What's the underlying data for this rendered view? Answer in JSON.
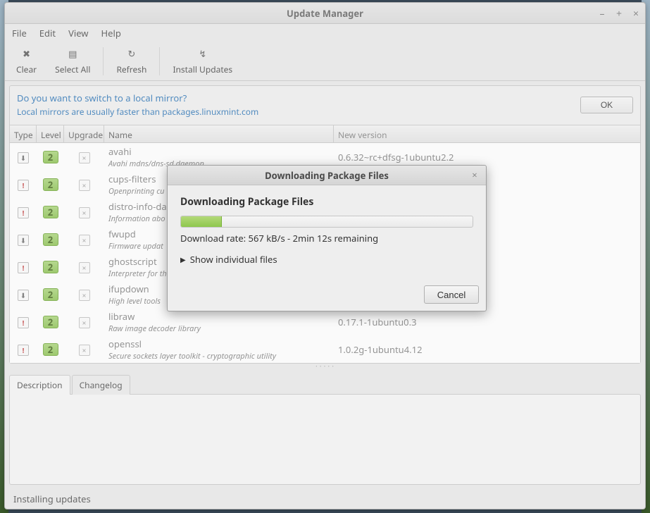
{
  "window": {
    "title": "Update Manager",
    "menu": {
      "file": "File",
      "edit": "Edit",
      "view": "View",
      "help": "Help"
    },
    "win_controls": {
      "min_icon": "minus-icon",
      "max_icon": "plus-icon",
      "close_icon": "close-icon"
    }
  },
  "toolbar": {
    "clear": "Clear",
    "select_all": "Select All",
    "refresh": "Refresh",
    "install_updates": "Install Updates"
  },
  "mirror": {
    "question": "Do you want to switch to a local mirror?",
    "subtext": "Local mirrors are usually faster than packages.linuxmint.com",
    "ok": "OK"
  },
  "columns": {
    "type": "Type",
    "level": "Level",
    "upgrade": "Upgrade",
    "name": "Name",
    "new_version": "New version"
  },
  "packages": [
    {
      "type": "down",
      "level": "2",
      "name": "avahi",
      "desc": "Avahi mdns/dns-sd daemon",
      "version": "0.6.32~rc+dfsg-1ubuntu2.2"
    },
    {
      "type": "warn",
      "level": "2",
      "name": "cups-filters",
      "desc": "Openprinting cu",
      "version": ""
    },
    {
      "type": "warn",
      "level": "2",
      "name": "distro-info-da",
      "desc": "Information abo",
      "version": ""
    },
    {
      "type": "down",
      "level": "2",
      "name": "fwupd",
      "desc": "Firmware updat",
      "version": ""
    },
    {
      "type": "warn",
      "level": "2",
      "name": "ghostscript",
      "desc": "Interpreter for th",
      "version": ""
    },
    {
      "type": "down",
      "level": "2",
      "name": "ifupdown",
      "desc": "High level tools",
      "version": ""
    },
    {
      "type": "warn",
      "level": "2",
      "name": "libraw",
      "desc": "Raw image decoder library",
      "version": "0.17.1-1ubuntu0.3"
    },
    {
      "type": "warn",
      "level": "2",
      "name": "openssl",
      "desc": "Secure sockets layer toolkit - cryptographic utility",
      "version": "1.0.2g-1ubuntu4.12"
    }
  ],
  "tabs": {
    "description": "Description",
    "changelog": "Changelog"
  },
  "status": "Installing updates",
  "dialog": {
    "title": "Downloading Package Files",
    "heading": "Downloading Package Files",
    "progress_percent": 14,
    "rate": "Download rate: 567 kB/s - 2min 12s remaining",
    "expander": "Show individual files",
    "cancel": "Cancel"
  }
}
